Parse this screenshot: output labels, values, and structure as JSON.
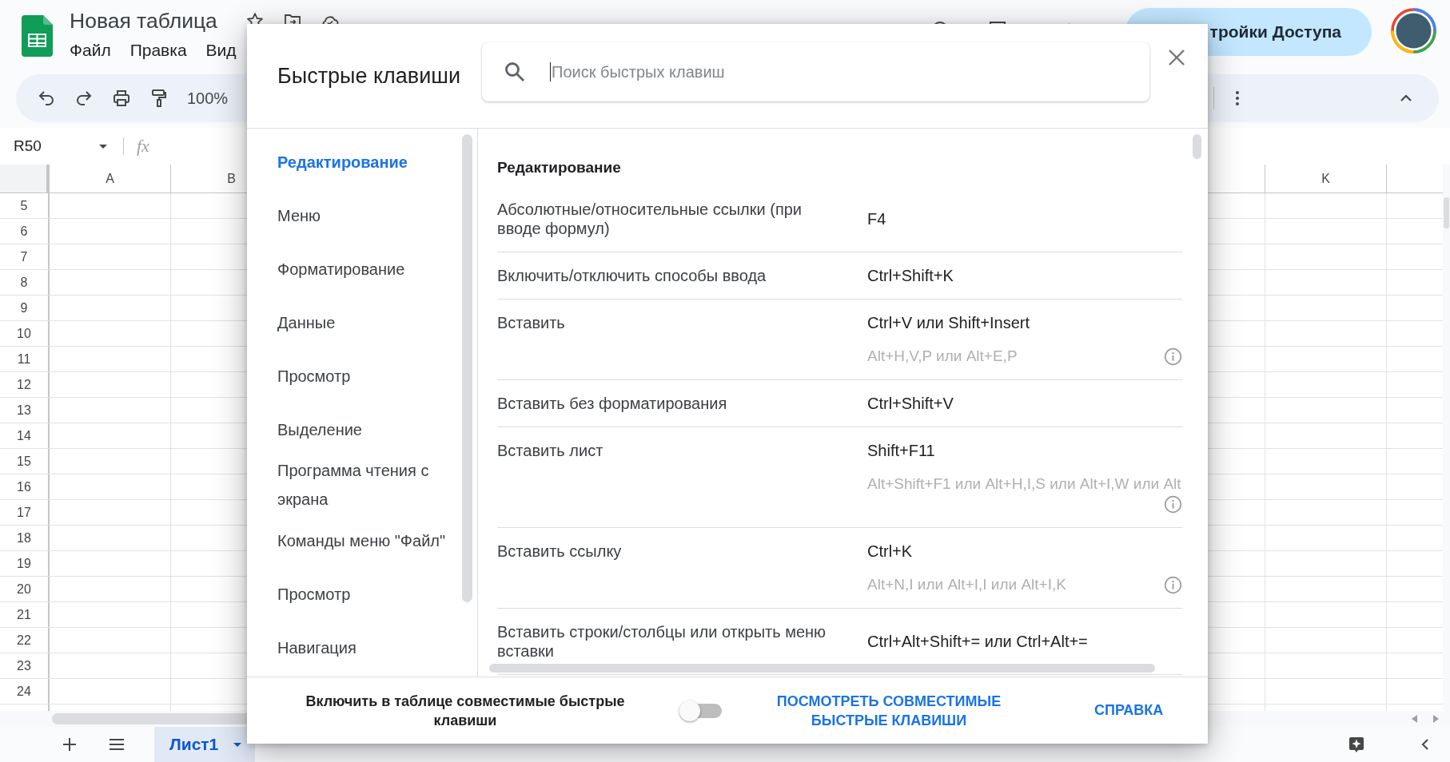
{
  "app": {
    "title": "Новая таблица",
    "menu": [
      "Файл",
      "Правка",
      "Вид"
    ],
    "access_button": "тройки Доступа",
    "zoom": "100%",
    "name_box": "R50",
    "formula_label": "fx"
  },
  "sheet": {
    "columns_left": [
      "A",
      "B"
    ],
    "columns_right": [
      "K"
    ],
    "rows": [
      "5",
      "6",
      "7",
      "8",
      "9",
      "10",
      "11",
      "12",
      "13",
      "14",
      "15",
      "16",
      "17",
      "18",
      "19",
      "20",
      "21",
      "22",
      "23",
      "24"
    ]
  },
  "sheet_tabs": [
    {
      "label": "Лист1",
      "selected": true
    }
  ],
  "dialog": {
    "title": "Быстрые клавиши",
    "search": {
      "placeholder": "Поиск быстрых клавиш"
    },
    "categories": [
      {
        "label": "Редактирование",
        "selected": true
      },
      {
        "label": "Меню",
        "selected": false
      },
      {
        "label": "Форматирование",
        "selected": false
      },
      {
        "label": "Данные",
        "selected": false
      },
      {
        "label": "Просмотр",
        "selected": false
      },
      {
        "label": "Выделение",
        "selected": false
      },
      {
        "label": "Программа чтения с экрана",
        "selected": false
      },
      {
        "label": "Команды меню \"Файл\"",
        "selected": false
      },
      {
        "label": "Просмотр",
        "selected": false
      },
      {
        "label": "Навигация",
        "selected": false
      }
    ],
    "section_title": "Редактирование",
    "shortcuts": [
      {
        "action": "Абсолютные/относительные ссылки (при вводе формул)",
        "keys": "F4"
      },
      {
        "action": "Включить/отключить способы ввода",
        "keys": "Ctrl+Shift+K"
      },
      {
        "action": "Вставить",
        "keys": "Ctrl+V или Shift+Insert",
        "alt_keys": "Alt+H,V,P или Alt+E,P"
      },
      {
        "action": "Вставить без форматирования",
        "keys": "Ctrl+Shift+V"
      },
      {
        "action": "Вставить лист",
        "keys": "Shift+F11",
        "alt_keys": "Alt+Shift+F1 или Alt+H,I,S или Alt+I,W или Alt"
      },
      {
        "action": "Вставить ссылку",
        "keys": "Ctrl+K",
        "alt_keys": "Alt+N,I или Alt+I,I или Alt+I,K"
      },
      {
        "action": "Вставить строки/столбцы или открыть меню вставки",
        "keys": "Ctrl+Alt+Shift+= или Ctrl+Alt+="
      }
    ],
    "footer": {
      "toggle_label": "Включить в таблице совместимые быстрые клавиши",
      "toggle_on": false,
      "view_link": "ПОСМОТРЕТЬ СОВМЕСТИМЫЕ БЫСТРЫЕ КЛАВИШИ",
      "help_link": "СПРАВКА"
    }
  }
}
